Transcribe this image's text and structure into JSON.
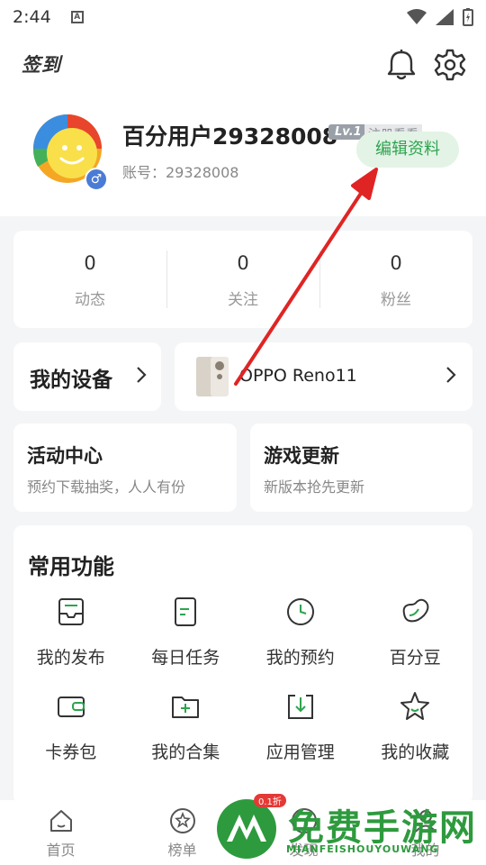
{
  "status_bar": {
    "time": "2:44",
    "notif_letter": "A"
  },
  "header": {
    "checkin_label": "签到"
  },
  "profile": {
    "username": "百分用户29328008",
    "level": "Lv.1",
    "register_hint": "注册看看",
    "account": "账号：29328008",
    "edit_button": "编辑资料",
    "gender_symbol": "♂"
  },
  "stats": [
    {
      "value": "0",
      "label": "动态"
    },
    {
      "value": "0",
      "label": "关注"
    },
    {
      "value": "0",
      "label": "粉丝"
    }
  ],
  "devices": {
    "title": "我的设备",
    "phone_name": "OPPO Reno11"
  },
  "activity": {
    "title": "活动中心",
    "subtitle": "预约下载抽奖，人人有份"
  },
  "games": {
    "title": "游戏更新",
    "subtitle": "新版本抢先更新"
  },
  "functions": {
    "title": "常用功能",
    "items": [
      {
        "label": "我的发布",
        "icon": "inbox-icon"
      },
      {
        "label": "每日任务",
        "icon": "task-list-icon"
      },
      {
        "label": "我的预约",
        "icon": "clock-icon"
      },
      {
        "label": "百分豆",
        "icon": "bean-icon"
      },
      {
        "label": "卡券包",
        "icon": "wallet-icon"
      },
      {
        "label": "我的合集",
        "icon": "folder-plus-icon"
      },
      {
        "label": "应用管理",
        "icon": "download-box-icon"
      },
      {
        "label": "我的收藏",
        "icon": "star-icon"
      }
    ]
  },
  "bottom_nav": [
    {
      "label": "首页",
      "icon": "home-icon"
    },
    {
      "label": "榜单",
      "icon": "star-circle-icon"
    },
    {
      "label": "发现",
      "icon": "discover-icon"
    },
    {
      "label": "我的",
      "icon": "user-icon"
    }
  ],
  "watermark": {
    "badge": "0.1折",
    "text": "免费手游网",
    "sub": "MIANFEISHOUYOUWANG"
  },
  "colors": {
    "accent_green": "#2da44e",
    "annotation_red": "#e02424"
  }
}
